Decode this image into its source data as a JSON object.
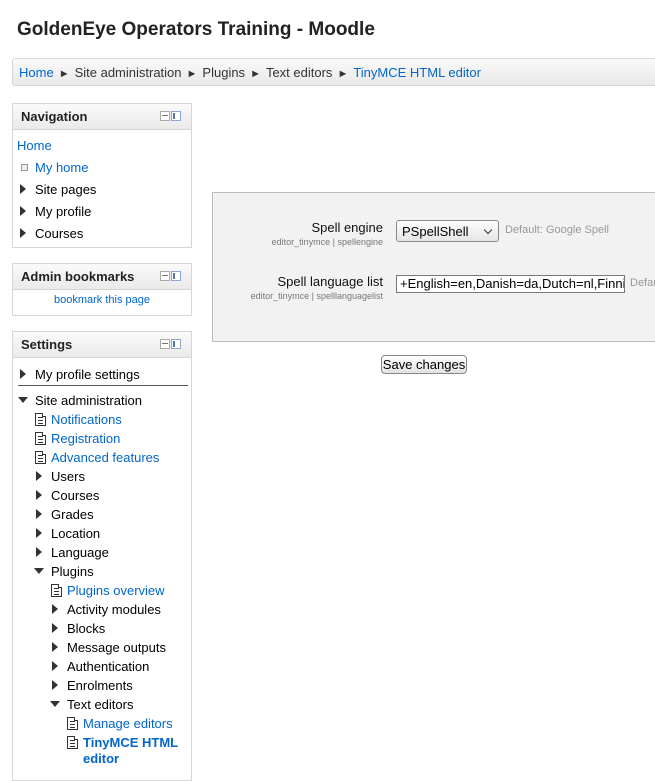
{
  "site_title": "GoldenEye Operators Training - Moodle",
  "breadcrumb": {
    "items": [
      "Home",
      "Site administration",
      "Plugins",
      "Text editors",
      "TinyMCE HTML editor"
    ],
    "separator": "►"
  },
  "navigation_block": {
    "title": "Navigation",
    "home": "Home",
    "my_home": "My home",
    "items": [
      "Site pages",
      "My profile",
      "Courses"
    ]
  },
  "admin_bookmarks_block": {
    "title": "Admin bookmarks",
    "link": "bookmark this page"
  },
  "settings_block": {
    "title": "Settings",
    "my_profile_settings": "My profile settings",
    "site_administration": "Site administration",
    "notifications": "Notifications",
    "registration": "Registration",
    "advanced_features": "Advanced features",
    "users": "Users",
    "courses": "Courses",
    "grades": "Grades",
    "location": "Location",
    "language": "Language",
    "plugins": "Plugins",
    "plugins_overview": "Plugins overview",
    "activity_modules": "Activity modules",
    "blocks": "Blocks",
    "message_outputs": "Message outputs",
    "authentication": "Authentication",
    "enrolments": "Enrolments",
    "text_editors": "Text editors",
    "manage_editors": "Manage editors",
    "tinymce_line1": "TinyMCE HTML",
    "tinymce_line2": "editor"
  },
  "form": {
    "spell_engine": {
      "label": "Spell engine",
      "setting_name": "editor_tinymce | spellengine",
      "value": "PSpellShell",
      "default": "Default: Google Spell"
    },
    "spell_language_list": {
      "label": "Spell language list",
      "setting_name": "editor_tinymce | spelllanguagelist",
      "value": "+English=en,Danish=da,Dutch=nl,Finnish=fi",
      "default": "Default"
    },
    "save_label": "Save changes"
  },
  "colors": {
    "link": "#0066cc",
    "panel_bg": "#f2f2f2",
    "block_border": "#d6d6d6"
  }
}
